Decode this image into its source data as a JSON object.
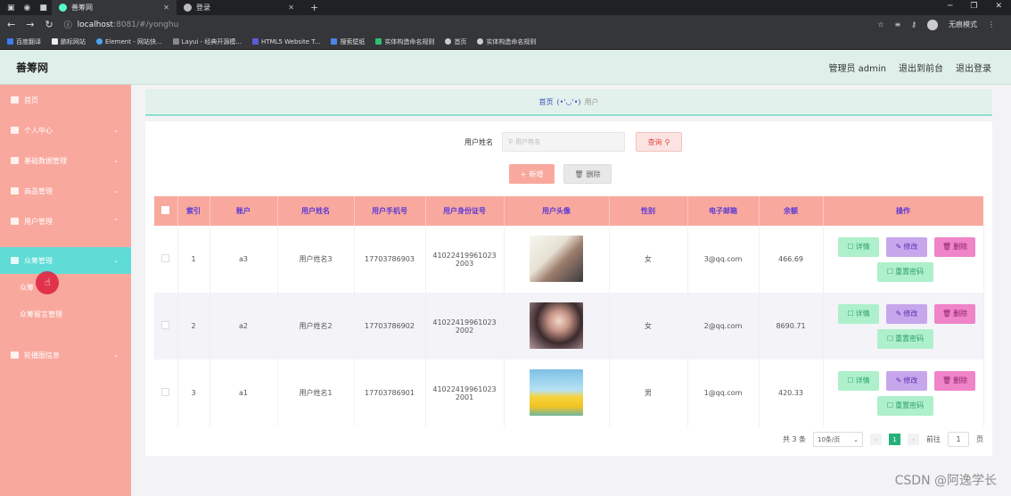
{
  "browser": {
    "tabs": [
      {
        "label": "善筹网",
        "active": true
      },
      {
        "label": "登录",
        "active": false
      }
    ],
    "url_host": "localhost",
    "url_path": ":8081/#/yonghu",
    "incognito_label": "无痕模式",
    "bookmarks": [
      "百度翻译",
      "鹏标网站",
      "Element - 网站快...",
      "Layui - 经典开源模...",
      "HTML5 Website T...",
      "搜索壁纸",
      "实体构造命名规则",
      "首页",
      "实体构造命名规则"
    ],
    "colors": {
      "chrome_dark": "#202124",
      "chrome": "#35363a"
    }
  },
  "header": {
    "brand": "善筹网",
    "admin": "管理员 admin",
    "front": "退出到前台",
    "logout": "退出登录"
  },
  "sidebar": {
    "items": [
      {
        "label": "首页"
      },
      {
        "label": "个人中心"
      },
      {
        "label": "基础数据管理"
      },
      {
        "label": "商品管理"
      },
      {
        "label": "用户管理"
      },
      {
        "label": "众筹管理"
      },
      {
        "label": "众筹"
      },
      {
        "label": "众筹留言管理"
      },
      {
        "label": "轮播图信息"
      }
    ],
    "colors": {
      "bg": "#f9a89e",
      "active": "#5fdcd6"
    }
  },
  "breadcrumb": {
    "home": "首页",
    "sep": "(•'◡'•)",
    "current": "用户"
  },
  "search": {
    "label": "用户姓名",
    "placeholder": "用户姓名",
    "button": "查询"
  },
  "actions": {
    "add": "新增",
    "delete": "删除"
  },
  "table": {
    "headers": [
      "索引",
      "账户",
      "用户姓名",
      "用户手机号",
      "用户身份证号",
      "用户头像",
      "性别",
      "电子邮箱",
      "余额",
      "操作"
    ],
    "rows": [
      {
        "index": "1",
        "account": "a3",
        "name": "用户姓名3",
        "phone": "17703786903",
        "id_a": "41022419961023",
        "id_b": "2003",
        "gender": "女",
        "email": "3@qq.com",
        "balance": "466.69"
      },
      {
        "index": "2",
        "account": "a2",
        "name": "用户姓名2",
        "phone": "17703786902",
        "id_a": "41022419961023",
        "id_b": "2002",
        "gender": "女",
        "email": "2@qq.com",
        "balance": "8690.71"
      },
      {
        "index": "3",
        "account": "a1",
        "name": "用户姓名1",
        "phone": "17703786901",
        "id_a": "41022419961023",
        "id_b": "2001",
        "gender": "男",
        "email": "1@qq.com",
        "balance": "420.33"
      }
    ],
    "op_labels": {
      "detail": "详情",
      "edit": "修改",
      "delete": "删除",
      "reset": "重置密码"
    }
  },
  "pagination": {
    "total": "共 3 条",
    "page_size": "10条/页",
    "current_page": "1",
    "goto": "前往",
    "page_unit": "页"
  },
  "watermark": "CSDN @阿逸学长"
}
